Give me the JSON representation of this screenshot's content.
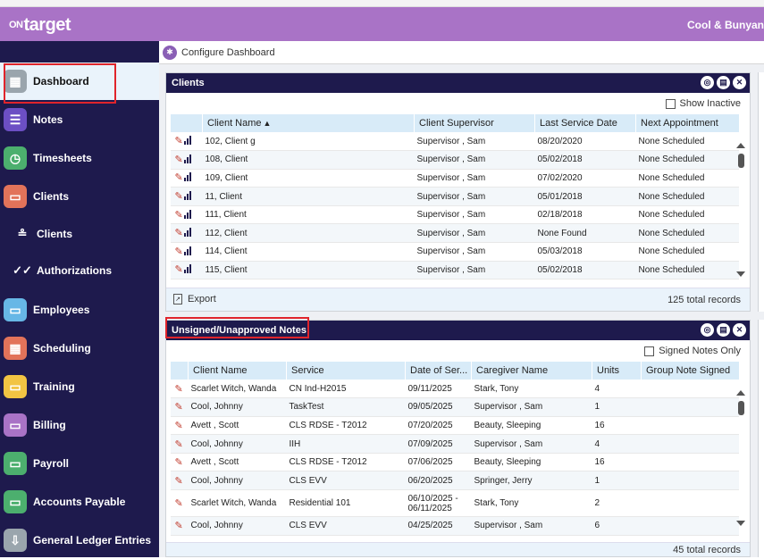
{
  "app": {
    "logo_on": "ON",
    "logo_target": "target",
    "company": "Cool & Bunyan"
  },
  "config": {
    "label": "Configure Dashboard"
  },
  "sidebar": {
    "items": [
      {
        "label": "Dashboard",
        "icon": "dashboard-icon",
        "color": "#9aa5ad"
      },
      {
        "label": "Notes",
        "icon": "notes-icon",
        "color": "#6c4fc4"
      },
      {
        "label": "Timesheets",
        "icon": "clock-icon",
        "color": "#4caf6e"
      },
      {
        "label": "Clients",
        "icon": "folder-icon",
        "color": "#e2735a"
      },
      {
        "label": "Employees",
        "icon": "folder-icon",
        "color": "#67b7e6"
      },
      {
        "label": "Scheduling",
        "icon": "calendar-icon",
        "color": "#e2735a"
      },
      {
        "label": "Training",
        "icon": "folder-icon",
        "color": "#f2c443"
      },
      {
        "label": "Billing",
        "icon": "folder-icon",
        "color": "#a973c6"
      },
      {
        "label": "Payroll",
        "icon": "folder-icon",
        "color": "#4caf6e"
      },
      {
        "label": "Accounts Payable",
        "icon": "folder-icon",
        "color": "#4caf6e"
      },
      {
        "label": "General Ledger Entries",
        "icon": "download-icon",
        "color": "#9aa5ad"
      }
    ],
    "subitems": [
      {
        "label": "Clients",
        "icon": "users-list-icon"
      },
      {
        "label": "Authorizations",
        "icon": "check-marks-icon"
      }
    ]
  },
  "clients_panel": {
    "title": "Clients",
    "show_inactive": "Show Inactive",
    "columns": [
      "Client Name",
      "Client Supervisor",
      "Last Service Date",
      "Next Appointment"
    ],
    "sort_indicator": "▲",
    "rows": [
      [
        "102, Client g",
        "Supervisor , Sam",
        "08/20/2020",
        "None Scheduled"
      ],
      [
        "108, Client",
        "Supervisor , Sam",
        "05/02/2018",
        "None Scheduled"
      ],
      [
        "109, Client",
        "Supervisor , Sam",
        "07/02/2020",
        "None Scheduled"
      ],
      [
        "11, Client",
        "Supervisor , Sam",
        "05/01/2018",
        "None Scheduled"
      ],
      [
        "111, Client",
        "Supervisor , Sam",
        "02/18/2018",
        "None Scheduled"
      ],
      [
        "112, Client",
        "Supervisor , Sam",
        "None Found",
        "None Scheduled"
      ],
      [
        "114, Client",
        "Supervisor , Sam",
        "05/03/2018",
        "None Scheduled"
      ],
      [
        "115, Client",
        "Supervisor , Sam",
        "05/02/2018",
        "None Scheduled"
      ]
    ],
    "export": "Export",
    "total": "125 total records"
  },
  "notes_panel": {
    "title": "Unsigned/Unapproved Notes",
    "signed_only": "Signed Notes Only",
    "columns": [
      "Client Name",
      "Service",
      "Date of Ser...",
      "Caregiver Name",
      "Units",
      "Group Note Signed"
    ],
    "rows": [
      [
        "Scarlet Witch, Wanda",
        "CN Ind-H2015",
        "09/11/2025",
        "Stark, Tony",
        "4",
        ""
      ],
      [
        "Cool, Johnny",
        "TaskTest",
        "09/05/2025",
        "Supervisor , Sam",
        "1",
        ""
      ],
      [
        "Avett , Scott",
        "CLS RDSE - T2012",
        "07/20/2025",
        "Beauty, Sleeping",
        "16",
        ""
      ],
      [
        "Cool, Johnny",
        "IIH",
        "07/09/2025",
        "Supervisor , Sam",
        "4",
        ""
      ],
      [
        "Avett , Scott",
        "CLS RDSE - T2012",
        "07/06/2025",
        "Beauty, Sleeping",
        "16",
        ""
      ],
      [
        "Cool, Johnny",
        "CLS EVV",
        "06/20/2025",
        "Springer, Jerry",
        "1",
        ""
      ],
      [
        "Scarlet Witch, Wanda",
        "Residential 101",
        "06/10/2025 - 06/11/2025",
        "Stark, Tony",
        "2",
        ""
      ],
      [
        "Cool, Johnny",
        "CLS EVV",
        "04/25/2025",
        "Supervisor , Sam",
        "6",
        ""
      ]
    ],
    "total": "45 total records"
  }
}
